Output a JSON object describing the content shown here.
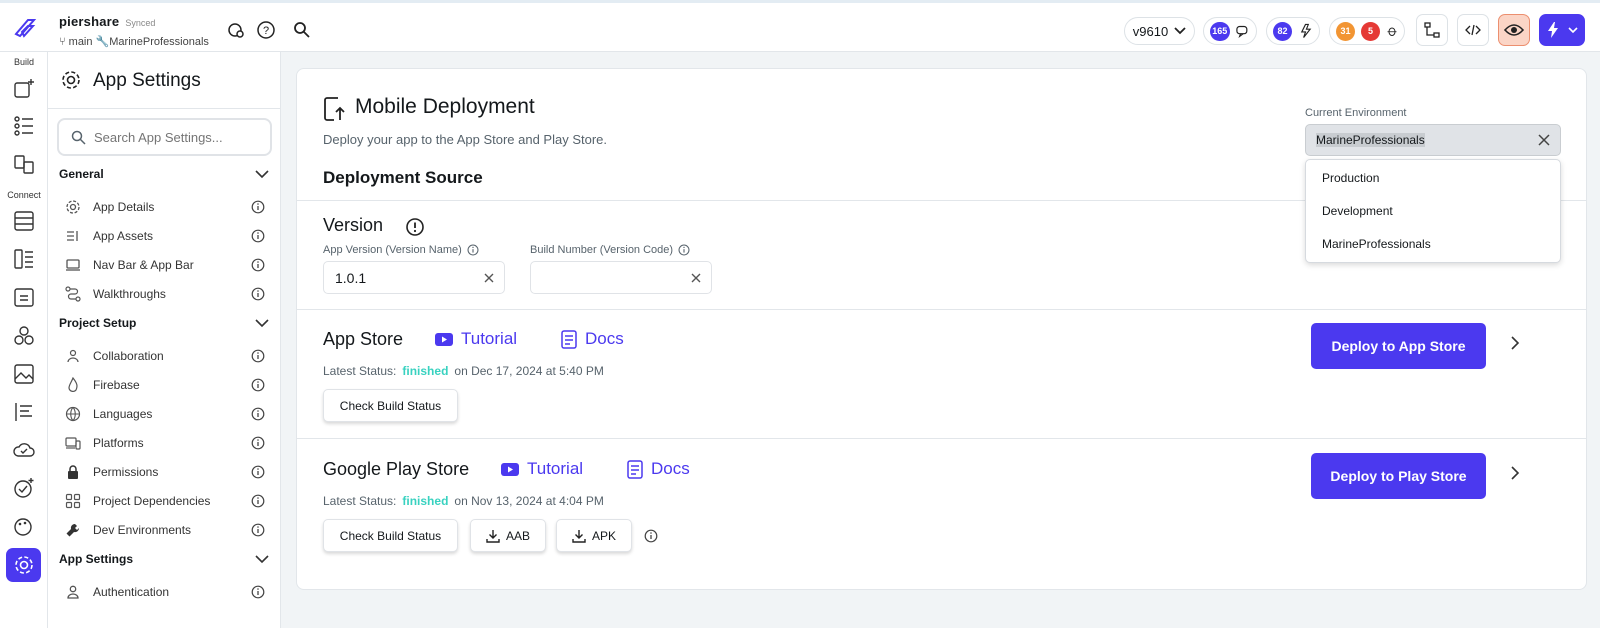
{
  "project": {
    "name": "piershare",
    "sync_status": "Synced",
    "branch": "main",
    "environment": "MarineProfessionals"
  },
  "topbar": {
    "version": "v9610",
    "comments_count": "165",
    "updates_count": "82",
    "warnings_count": "31",
    "errors_count": "5"
  },
  "rail": {
    "build_label": "Build",
    "connect_label": "Connect"
  },
  "sidebar": {
    "title": "App Settings",
    "search_placeholder": "Search App Settings...",
    "sections": [
      {
        "label": "General",
        "items": [
          "App Details",
          "App Assets",
          "Nav Bar & App Bar",
          "Walkthroughs"
        ]
      },
      {
        "label": "Project Setup",
        "items": [
          "Collaboration",
          "Firebase",
          "Languages",
          "Platforms",
          "Permissions",
          "Project Dependencies",
          "Dev Environments"
        ]
      },
      {
        "label": "App Settings",
        "items": [
          "Authentication"
        ]
      }
    ]
  },
  "main": {
    "title": "Mobile Deployment",
    "subtitle": "Deploy your app to the App Store and Play Store.",
    "deployment_source": "Deployment Source",
    "current_env_label": "Current Environment",
    "current_env_value": "MarineProfessionals",
    "env_options": [
      "Production",
      "Development",
      "MarineProfessionals"
    ],
    "version_title": "Version",
    "app_version_label": "App Version (Version Name)",
    "app_version_value": "1.0.1",
    "build_number_label": "Build Number (Version Code)",
    "build_number_value": "",
    "app_store": {
      "title": "App Store",
      "tutorial": "Tutorial",
      "docs": "Docs",
      "status_label": "Latest Status:",
      "status": "finished",
      "status_date": "on Dec 17, 2024 at 5:40 PM",
      "check_label": "Check Build Status",
      "deploy_label": "Deploy to App Store"
    },
    "play_store": {
      "title": "Google Play Store",
      "tutorial": "Tutorial",
      "docs": "Docs",
      "status_label": "Latest Status:",
      "status": "finished",
      "status_date": "on Nov 13, 2024 at 4:04 PM",
      "check_label": "Check Build Status",
      "aab_label": "AAB",
      "apk_label": "APK",
      "deploy_label": "Deploy to Play Store"
    }
  },
  "colors": {
    "accent": "#4b39ef",
    "success": "#39d2c0",
    "warning": "#f29533",
    "error": "#e53935"
  }
}
